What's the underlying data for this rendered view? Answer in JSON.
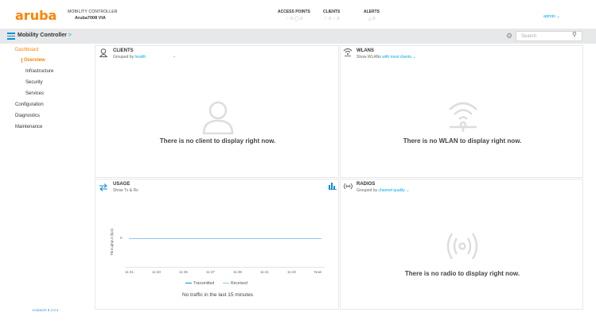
{
  "header": {
    "logo": "aruba",
    "controller_type": "MOBILITY CONTROLLER",
    "controller_name": "Aruba7008 VIA",
    "stats": [
      {
        "title": "ACCESS POINTS",
        "values": "♡ 0   ◯ 0"
      },
      {
        "title": "CLIENTS",
        "values": "♡ 0   ♂ 0"
      },
      {
        "title": "ALERTS",
        "values": "△ 0"
      }
    ],
    "user": "admin ⌄"
  },
  "toolbar": {
    "breadcrumb": "Mobility Controller",
    "breadcrumb_chevron": ">",
    "search_placeholder": "Search"
  },
  "sidebar": {
    "items": [
      {
        "label": "Dashboard"
      },
      {
        "label": "Overview"
      },
      {
        "label": "Infrastructure"
      },
      {
        "label": "Security"
      },
      {
        "label": "Services"
      },
      {
        "label": "Configuration"
      },
      {
        "label": "Diagnostics"
      },
      {
        "label": "Maintenance"
      }
    ],
    "version": "ArubaOS 8.4.0.4"
  },
  "panels": {
    "clients": {
      "title": "CLIENTS",
      "sub_prefix": "Grouped by",
      "sub_link": "health",
      "empty": "There is no client to display right now."
    },
    "wlans": {
      "title": "WLANS",
      "sub_prefix": "Show WLANs",
      "sub_link": "with most clients ⌄",
      "empty": "There is no WLAN to display right now."
    },
    "usage": {
      "title": "USAGE",
      "sub": "Show Tx & Rx",
      "y_label": "Throughput (bps)",
      "y_tick": "0",
      "x_ticks": [
        "11:31",
        "11:33",
        "11:35",
        "11:37",
        "11:39",
        "11:41",
        "11:43",
        "Now"
      ],
      "legend_tx": "Transmitted",
      "legend_rx": "Received",
      "empty": "No traffic in the last 15 minutes"
    },
    "radios": {
      "title": "RADIOS",
      "sub_prefix": "Grouped by",
      "sub_link": "channel quality ⌄",
      "empty": "There is no radio to display right now."
    }
  },
  "colors": {
    "brand": "#ff8300",
    "accent": "#01a9f4",
    "toolbar_bg": "#e6e8ea"
  }
}
